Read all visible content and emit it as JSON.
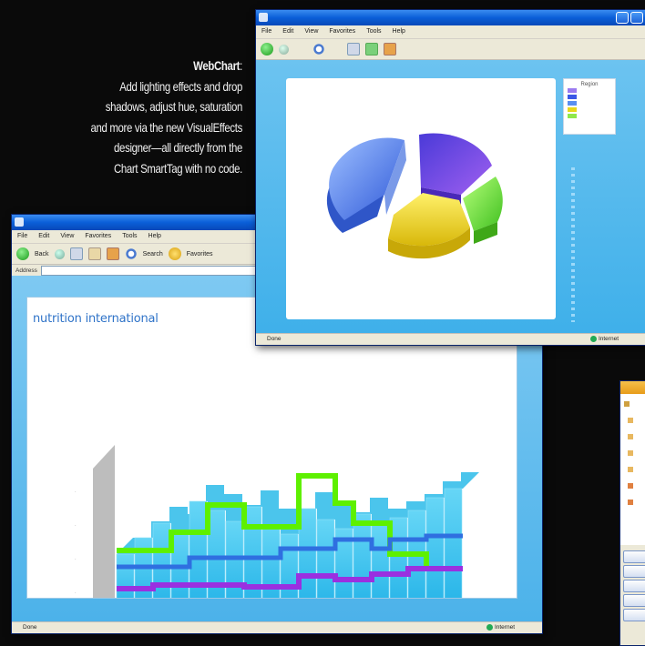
{
  "caption": {
    "title": "WebChart",
    "title_suffix": ":",
    "lines": [
      "Add lighting effects and drop",
      "shadows, adjust hue, saturation",
      "and more via the new VisualEffects",
      "designer—all directly from the",
      "Chart SmartTag with no code."
    ]
  },
  "bar_chart_window": {
    "chart_title": "nutrition international",
    "menu": [
      "File",
      "Edit",
      "View",
      "Favorites",
      "Tools",
      "Help"
    ],
    "toolbar": {
      "back": "Back",
      "search": "Search",
      "favorites": "Favorites"
    },
    "address_label": "Address",
    "status_left": "Done",
    "status_right": "Internet"
  },
  "pie_chart_window": {
    "menu": [
      "File",
      "Edit",
      "View",
      "Favorites",
      "Tools",
      "Help"
    ],
    "legend_title": "Region",
    "status_left": "Done",
    "status_right": "Internet"
  },
  "colors": {
    "xp_blue": "#0a5fd8",
    "window_face": "#ece9d8",
    "bar_cyan": "#3ec7ef",
    "line_green": "#5ef000",
    "line_blue": "#2f6fe0",
    "line_purple": "#9a30e0",
    "pie_blue": "#4a78e8",
    "pie_violet": "#6a40e0",
    "pie_yellow": "#e8d21a",
    "pie_green": "#6edc2c",
    "caption_text": "#f0f0f0"
  }
}
